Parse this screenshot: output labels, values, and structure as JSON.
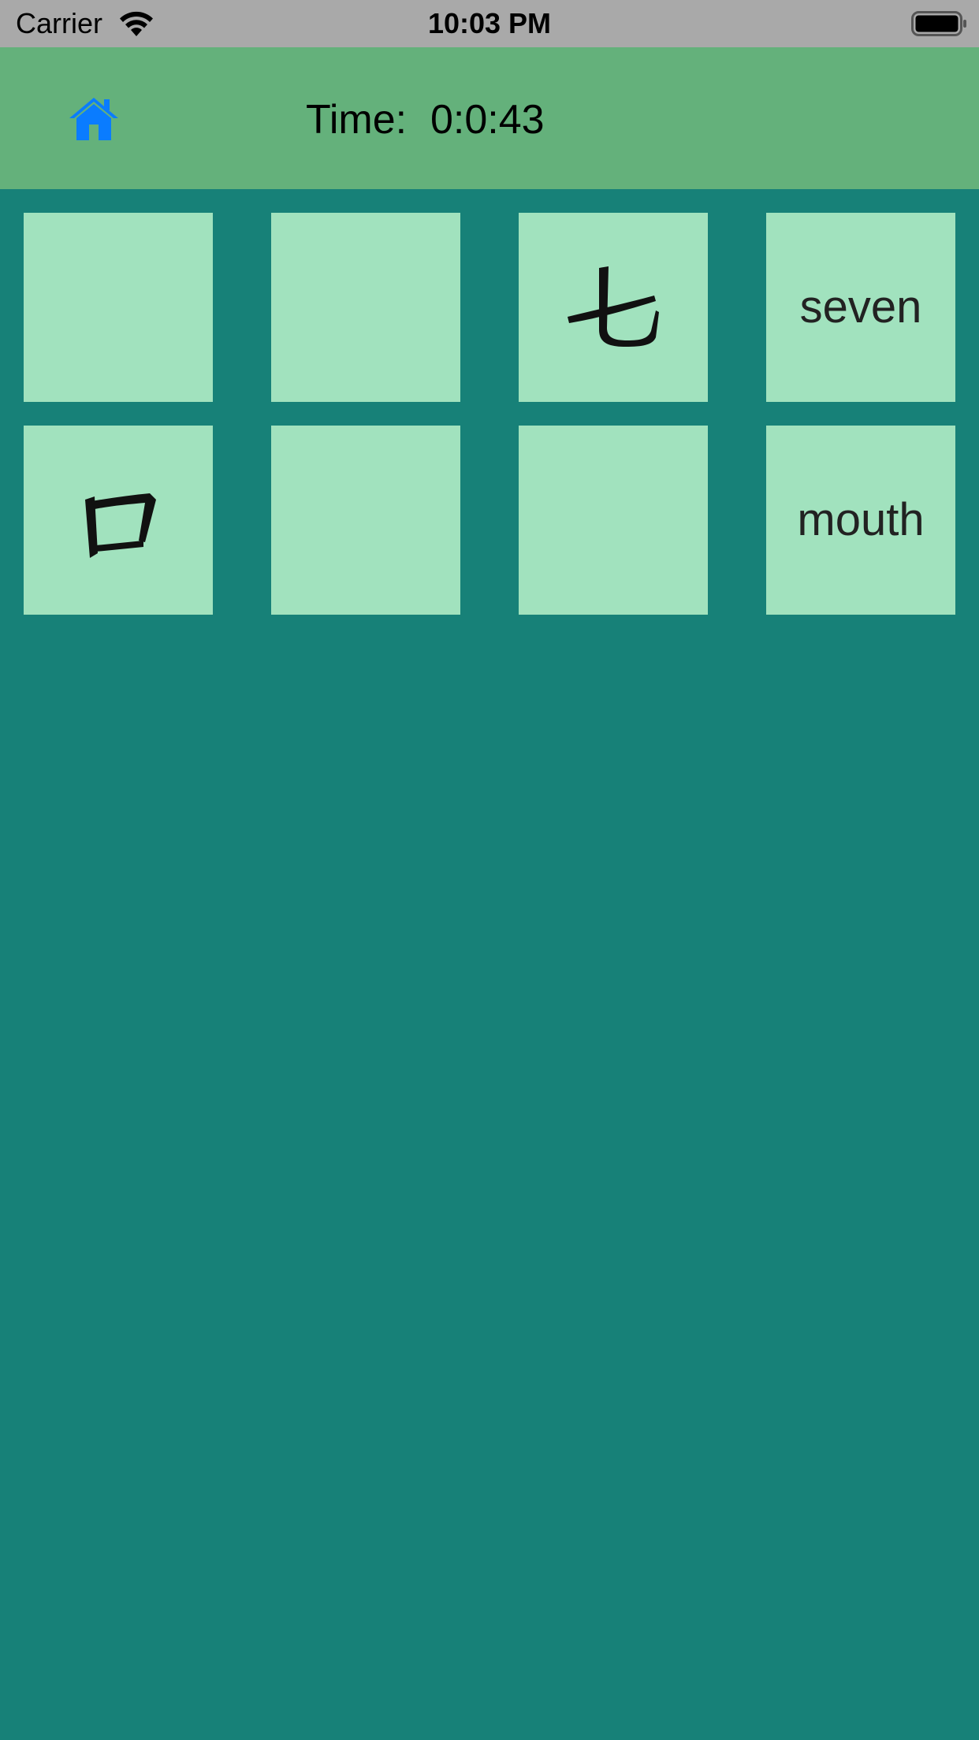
{
  "status_bar": {
    "carrier": "Carrier",
    "time": "10:03 PM",
    "wifi_icon": "wifi-icon",
    "battery_icon": "battery-full-icon"
  },
  "header": {
    "home_icon": "home-icon",
    "accent": "#0a7cff",
    "timer_label": "Time:",
    "timer_value": "0:0:43",
    "background": "#64b17b"
  },
  "board": {
    "background": "#178178",
    "card_color": "#a1e2be",
    "cards": [
      {
        "state": "face-down",
        "content": ""
      },
      {
        "state": "face-down",
        "content": ""
      },
      {
        "state": "face-up",
        "content": "七",
        "kind": "character"
      },
      {
        "state": "face-up",
        "content": "seven",
        "kind": "word"
      },
      {
        "state": "face-up",
        "content": "口",
        "kind": "character"
      },
      {
        "state": "face-down",
        "content": ""
      },
      {
        "state": "face-down",
        "content": ""
      },
      {
        "state": "face-up",
        "content": "mouth",
        "kind": "word"
      }
    ]
  }
}
